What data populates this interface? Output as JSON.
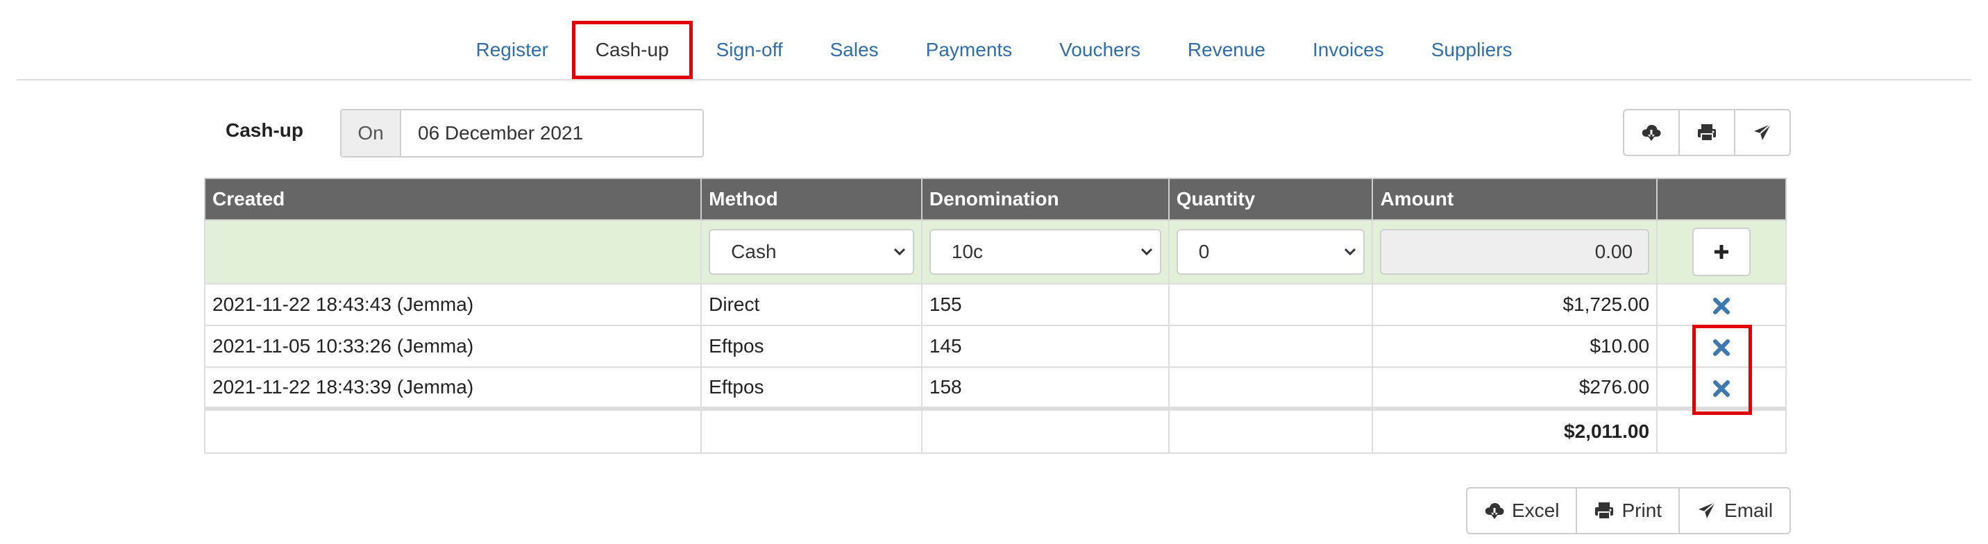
{
  "nav": {
    "tabs": [
      {
        "label": "Register"
      },
      {
        "label": "Cash-up",
        "active": true
      },
      {
        "label": "Sign-off"
      },
      {
        "label": "Sales"
      },
      {
        "label": "Payments"
      },
      {
        "label": "Vouchers"
      },
      {
        "label": "Revenue"
      },
      {
        "label": "Invoices"
      },
      {
        "label": "Suppliers"
      }
    ]
  },
  "header": {
    "title": "Cash-up",
    "date_prefix": "On",
    "date_value": "06 December 2021"
  },
  "toolbar_icons": [
    "cloud-download-icon",
    "print-icon",
    "send-icon"
  ],
  "table": {
    "columns": [
      "Created",
      "Method",
      "Denomination",
      "Quantity",
      "Amount"
    ],
    "entry": {
      "method": "Cash",
      "denomination": "10c",
      "quantity": "0",
      "amount": "0.00"
    },
    "rows": [
      {
        "created": "2021-11-22 18:43:43 (Jemma)",
        "method": "Direct",
        "denomination": "155",
        "quantity": "",
        "amount": "$1,725.00"
      },
      {
        "created": "2021-11-05 10:33:26 (Jemma)",
        "method": "Eftpos",
        "denomination": "145",
        "quantity": "",
        "amount": "$10.00"
      },
      {
        "created": "2021-11-22 18:43:39 (Jemma)",
        "method": "Eftpos",
        "denomination": "158",
        "quantity": "",
        "amount": "$276.00"
      }
    ],
    "total": "$2,011.00"
  },
  "export": {
    "excel": "Excel",
    "print": "Print",
    "email": "Email"
  },
  "colors": {
    "link": "#2f6ea7",
    "header_bg": "#666666",
    "entry_bg": "#e2f0da",
    "delete_icon": "#3d78b0",
    "highlight": "#e00000"
  }
}
